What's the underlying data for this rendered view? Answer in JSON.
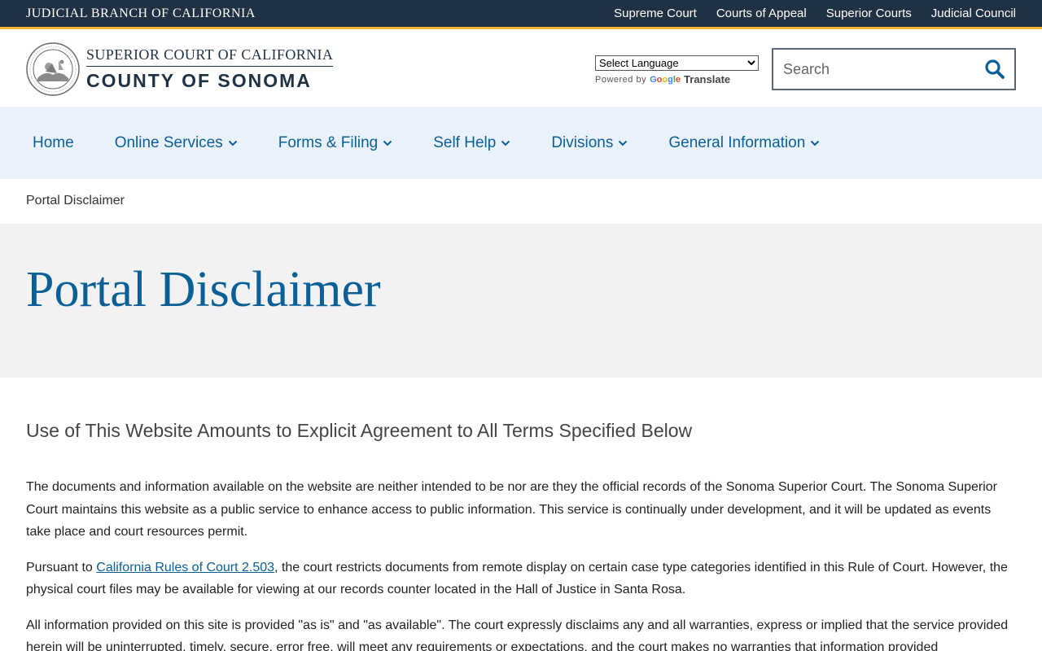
{
  "topbar": {
    "branch_title": "JUDICIAL BRANCH OF CALIFORNIA",
    "links": [
      "Supreme Court",
      "Courts of Appeal",
      "Superior Courts",
      "Judicial Council"
    ]
  },
  "header": {
    "logo_line1": "SUPERIOR COURT OF CALIFORNIA",
    "logo_line2": "COUNTY OF SONOMA",
    "translate": {
      "select_value": "Select Language",
      "powered_by": "Powered by",
      "google": "Google",
      "translate_word": "Translate"
    },
    "search": {
      "placeholder": "Search"
    }
  },
  "nav": {
    "items": [
      {
        "label": "Home"
      },
      {
        "label": "Online Services"
      },
      {
        "label": "Forms & Filing"
      },
      {
        "label": "Self Help"
      },
      {
        "label": "Divisions"
      },
      {
        "label": "General Information"
      }
    ]
  },
  "breadcrumb": {
    "current": "Portal Disclaimer"
  },
  "hero": {
    "title": "Portal Disclaimer"
  },
  "content": {
    "heading": "Use of This Website Amounts to Explicit Agreement to All Terms Specified Below",
    "p1": "The documents and information available on the website are neither intended to be nor are they the official records of the Sonoma Superior Court. The Sonoma Superior Court maintains this website as a public service to enhance access to public information. This service is continually under development, and it will be updated as events take place and court resources permit.",
    "p2_prefix": "Pursuant to ",
    "p2_link": "California Rules of Court 2.503",
    "p2_suffix": ", the court restricts documents from remote display on certain case type categories identified in this Rule of Court. However, the physical court files may be available for viewing at our records counter located in the Hall of Justice in Santa Rosa.",
    "p3": "All information provided on this site is provided \"as is\" and \"as available\". The court expressly disclaims any and all warranties, express or implied that the service provided herein will be uninterrupted, timely, secure, error free, will meet any requirements or expectations, and the court makes no warranties that information provided"
  },
  "colors": {
    "topbar_bg": "#1f3143",
    "accent_stripe": "#f2b632",
    "link_blue": "#0b5f97",
    "nav_bg": "#e9f2fa",
    "hero_bg": "#f2f2f2"
  }
}
